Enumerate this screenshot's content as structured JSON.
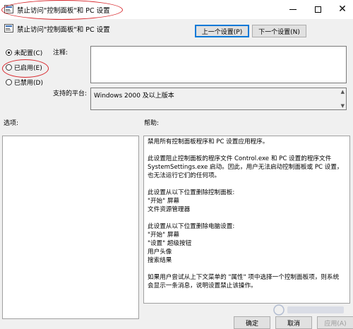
{
  "window": {
    "title": "禁止访问\"控制面板\"和 PC 设置",
    "minimize_icon": "minimize-icon",
    "maximize_icon": "maximize-icon",
    "close_glyph": "✕"
  },
  "policy": {
    "name": "禁止访问\"控制面板\"和 PC 设置"
  },
  "nav": {
    "prev_label": "上一个设置(P)",
    "next_label": "下一个设置(N)"
  },
  "state": {
    "options": [
      {
        "label": "未配置(C)",
        "checked": true
      },
      {
        "label": "已启用(E)",
        "checked": false
      },
      {
        "label": "已禁用(D)",
        "checked": false
      }
    ]
  },
  "labels": {
    "comment": "注释:",
    "supported": "支持的平台:",
    "options": "选项:",
    "help": "帮助:"
  },
  "supported_value": "Windows 2000 及以上版本",
  "help_lines": [
    "禁用所有控制面板程序和 PC 设置应用程序。",
    "",
    "此设置阻止控制面板的程序文件 Control.exe 和 PC 设置的程序文件",
    "SystemSettings.exe 启动。因此，用户无法启动控制面板或 PC 设置，",
    "也无法运行它们的任何项。",
    "",
    "此设置从以下位置删除控制面板:",
    "  \"开始\" 屏幕",
    "文件资源管理器",
    "",
    "此设置从以下位置删除电脑设置:",
    "  \"开始\" 屏幕",
    "  \"设置\" 超级按钮",
    "用户头像",
    "搜索结果",
    "",
    "如果用户尝试从上下文菜单的 \"属性\" 项中选择一个控制面板项，则系统",
    "会显示一条消息，说明设置禁止该操作。"
  ],
  "buttons": {
    "ok": "确定",
    "cancel": "取消",
    "apply": "应用(A)"
  },
  "colors": {
    "annotation": "#d8272c",
    "accent": "#0078d7",
    "window_bg": "#f0f0f0"
  }
}
